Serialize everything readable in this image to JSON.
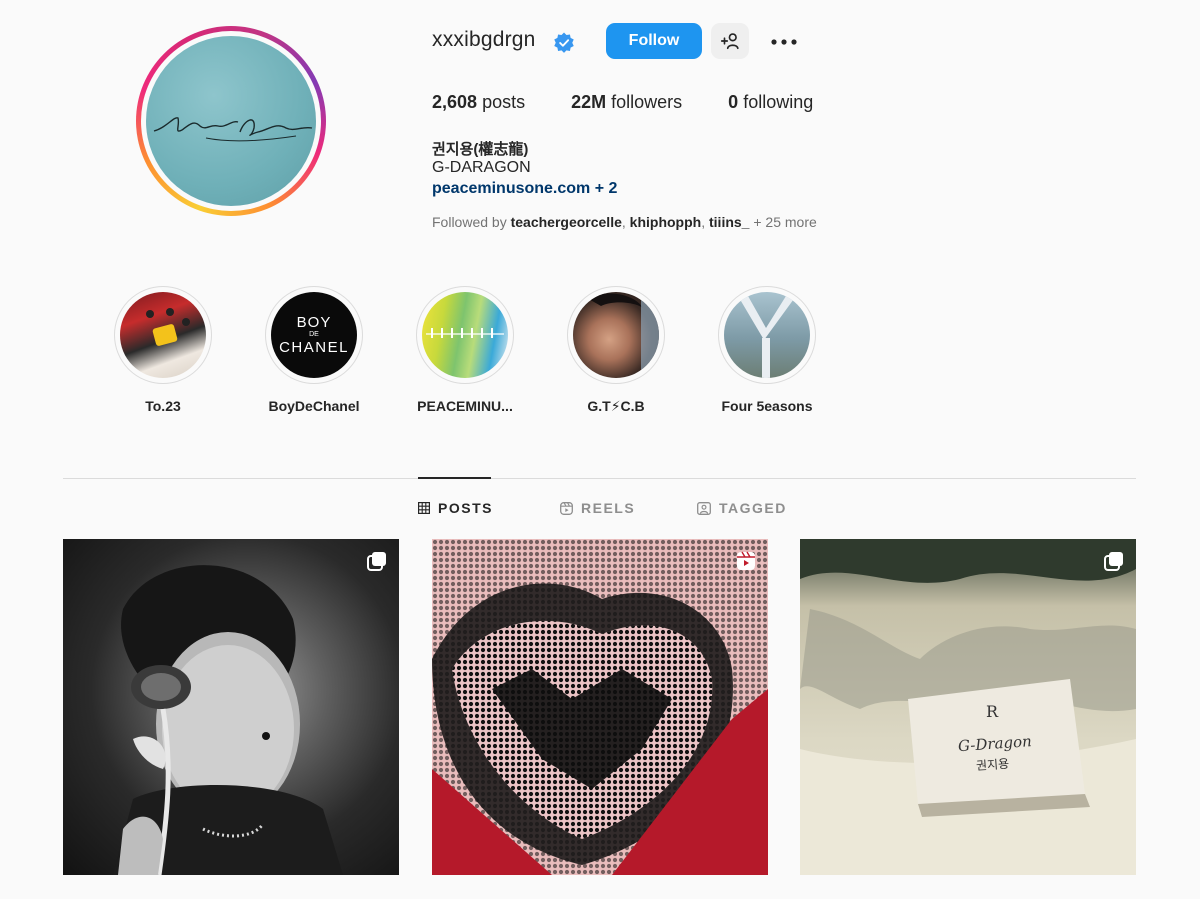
{
  "profile": {
    "username": "xxxibgdrgn",
    "verified": true,
    "follow_label": "Follow",
    "avatar_signature": "Monsieur G-Dragon",
    "stats": {
      "posts_count": "2,608",
      "posts_label": "posts",
      "followers_count": "22M",
      "followers_label": "followers",
      "following_count": "0",
      "following_label": "following"
    },
    "bio": {
      "name": "권지용(權志龍)",
      "line": "G-DARAGON",
      "link": "peaceminusone.com + 2"
    },
    "followed_by": {
      "prefix": "Followed by",
      "users": [
        "teachergeorcelle",
        "khiphopph",
        "tiiins_"
      ],
      "more": "+ 25 more"
    }
  },
  "highlights": [
    {
      "label": "To.23"
    },
    {
      "label": "BoyDeChanel",
      "image_text": [
        "BOY",
        "DE",
        "CHANEL"
      ]
    },
    {
      "label": "PEACEMINU..."
    },
    {
      "label": "G.T⚡C.B"
    },
    {
      "label": "Four 5easons"
    }
  ],
  "tabs": [
    {
      "label": "POSTS",
      "icon": "grid-icon",
      "active": true
    },
    {
      "label": "REELS",
      "icon": "reels-icon",
      "active": false
    },
    {
      "label": "TAGGED",
      "icon": "tagged-icon",
      "active": false
    }
  ],
  "posts": [
    {
      "type": "carousel",
      "badge_icon": "carousel-icon"
    },
    {
      "type": "reel",
      "badge_icon": "reel-icon"
    },
    {
      "type": "carousel",
      "badge_icon": "carousel-icon",
      "card_text": [
        "G-Dragon",
        "권지용"
      ]
    }
  ],
  "colors": {
    "follow_button": "#1e95f0",
    "link": "#00376b",
    "verified_badge": "#3897f0"
  }
}
